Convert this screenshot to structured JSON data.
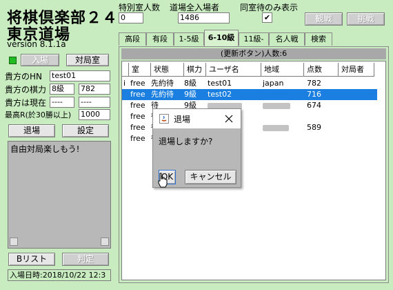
{
  "app": {
    "title_line1": "将棋倶楽部２４",
    "title_line2": "東京道場",
    "version": "version 8.1.1a"
  },
  "top": {
    "special_room_label": "特別室人数",
    "special_room_value": "0",
    "dojo_total_label": "道場全入場者",
    "dojo_total_value": "1486",
    "same_room_label": "同室待のみ表示",
    "same_room_checked": "✔",
    "spectate_button": "観戦",
    "challenge_button": "挑戦"
  },
  "left": {
    "enter_button": "入場",
    "match_room_button": "対局室",
    "hn_label": "貴方のHN",
    "hn_value": "test01",
    "rating_label": "貴方の棋力",
    "rating_rank": "8級",
    "rating_points": "782",
    "current_label": "貴方は現在",
    "current_value1": "----",
    "current_value2": "----",
    "max_label": "最高R(於30勝以上)",
    "max_value": "1000",
    "exit_button": "退場",
    "settings_button": "設定",
    "chat_text": "自由対局楽しもう!",
    "blist_button": "Bリスト",
    "judge_button": "判定",
    "entry_time": "入場日時:2018/10/22 12:3"
  },
  "tabs": [
    "高段",
    "有段",
    "1-5級",
    "6-10級",
    "11級-",
    "名人戦",
    "検索"
  ],
  "active_tab": "6-10級",
  "list": {
    "header": "(更新ボタン)人数:6",
    "columns": [
      "室",
      "状態",
      "棋力",
      "ユーザ名",
      "地域",
      "点数",
      "対局者"
    ],
    "rows": [
      {
        "mark": "i",
        "room": "free",
        "status": "先約待",
        "rank": "8級",
        "user": "test01",
        "region": "japan",
        "points": "782",
        "selected": false
      },
      {
        "mark": "",
        "room": "free",
        "status": "先約待",
        "rank": "9級",
        "user": "test02",
        "region": "",
        "points": "716",
        "selected": true
      },
      {
        "mark": "",
        "room": "free",
        "status": "待",
        "rank": "9級",
        "user": "",
        "region": "",
        "points": "674",
        "selected": false
      },
      {
        "mark": "",
        "room": "free",
        "status": "待",
        "rank": "",
        "user": "",
        "region": "",
        "points": "",
        "selected": false
      },
      {
        "mark": "",
        "room": "free",
        "status": "待",
        "rank": "",
        "user": "",
        "region": "",
        "points": "589",
        "selected": false
      },
      {
        "mark": "",
        "room": "free",
        "status": "待",
        "rank": "",
        "user": "",
        "region": "",
        "points": "",
        "selected": false
      }
    ]
  },
  "dialog": {
    "title": "退場",
    "message": "退場しますか?",
    "ok_button": "OK",
    "cancel_button": "キャンセル"
  },
  "colors": {
    "background": "#c8ecc0",
    "selection": "#1a7fe0",
    "indicator": "#22bb22"
  }
}
